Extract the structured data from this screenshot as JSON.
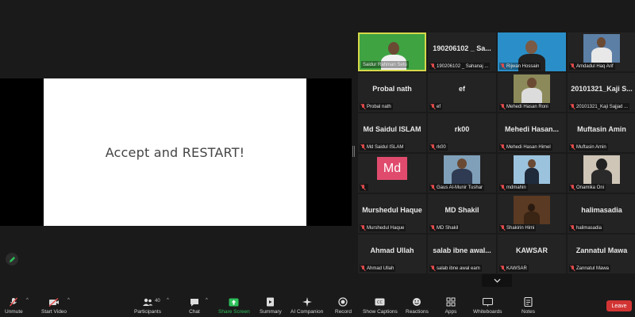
{
  "share": {
    "slide_text": "Accept and RESTART!"
  },
  "gallery": {
    "tiles": [
      {
        "big": "",
        "label": "Saidur Rahman Setu"
      },
      {
        "big": "190206102 _ Sa...",
        "label": "190206102 _ Sahanaj ..."
      },
      {
        "big": "",
        "label": "Rijwan Hossain"
      },
      {
        "big": "",
        "label": "Amdadul Haq Arif"
      },
      {
        "big": "Probal nath",
        "label": "Probal nath"
      },
      {
        "big": "ef",
        "label": "ef"
      },
      {
        "big": "",
        "label": "Mehedi Hasan Roni"
      },
      {
        "big": "20101321_Kaji S...",
        "label": "20101321_Kaji Sajjad ..."
      },
      {
        "big": "Md Saidul ISLAM",
        "label": "Md Saidul ISLAM"
      },
      {
        "big": "rk00",
        "label": "rk00"
      },
      {
        "big": "Mehedi Hasan...",
        "label": "Mehedi Hasan Himel"
      },
      {
        "big": "Muftasin Amin",
        "label": "Muftasin Amin"
      },
      {
        "big": "Md",
        "label": ""
      },
      {
        "big": "",
        "label": "Gaus Al-Munir Tushar"
      },
      {
        "big": "",
        "label": "mdmahin"
      },
      {
        "big": "",
        "label": "Onamika Oni"
      },
      {
        "big": "Murshedul Haque",
        "label": "Murshedul Haque"
      },
      {
        "big": "MD Shakil",
        "label": "MD Shakil"
      },
      {
        "big": "",
        "label": "Shakirin Himi"
      },
      {
        "big": "halimasadia",
        "label": "halimasadia"
      },
      {
        "big": "Ahmad Ullah",
        "label": "Ahmad Ullah"
      },
      {
        "big": "salab ibne awal...",
        "label": "salab ibne awal eam"
      },
      {
        "big": "KAWSAR",
        "label": "KAWSAR"
      },
      {
        "big": "Zannatul Mawa",
        "label": "Zannatul Mawa"
      }
    ]
  },
  "toolbar": {
    "unmute": "Unmute",
    "start_video": "Start Video",
    "participants": "Participants",
    "participants_count": "40",
    "chat": "Chat",
    "share_screen": "Share Screen",
    "summary": "Summary",
    "ai_companion": "AI Companion",
    "record": "Record",
    "show_captions": "Show Captions",
    "reactions": "Reactions",
    "apps": "Apps",
    "whiteboards": "Whiteboards",
    "notes": "Notes",
    "leave": "Leave",
    "share_color": "#2dbf5a",
    "leave_color": "#d23434"
  }
}
